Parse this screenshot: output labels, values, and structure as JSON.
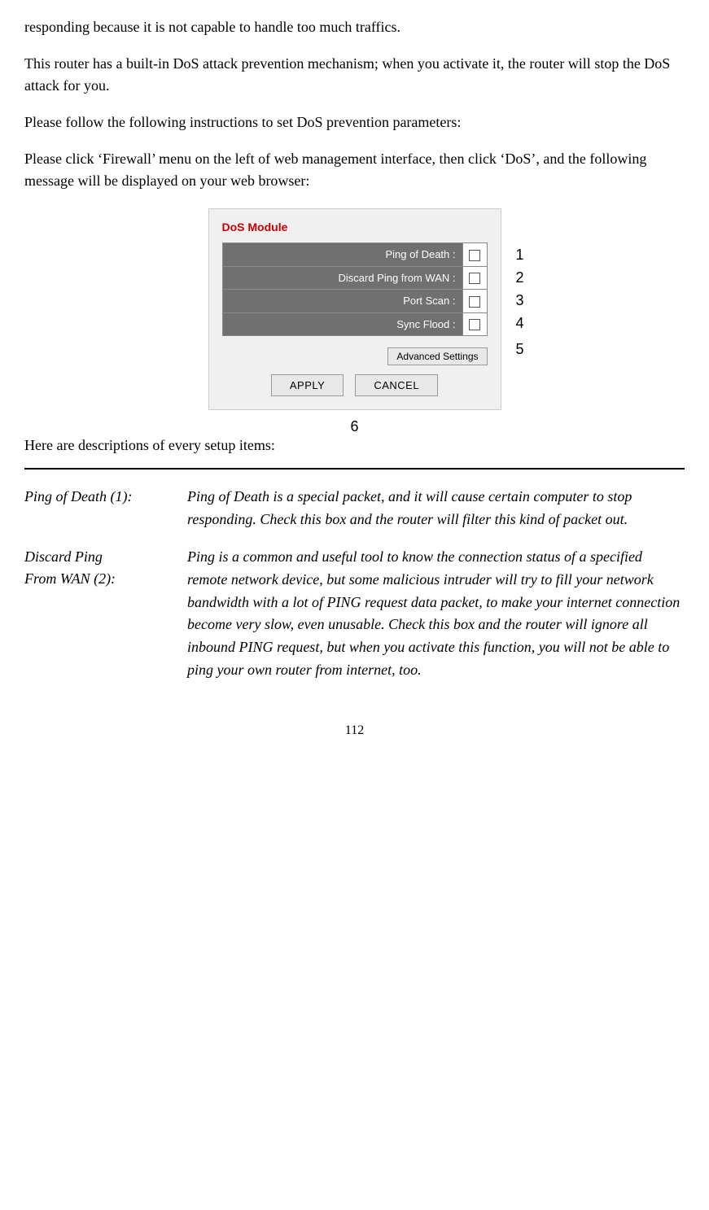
{
  "intro": {
    "para1": "responding because it is not capable to handle too much traffics.",
    "para2": "This router has a built-in DoS attack prevention mechanism; when you activate it, the router will stop the DoS attack for you.",
    "para3": "Please follow the following instructions to set DoS prevention parameters:",
    "para4": "Please click ‘Firewall’ menu on the left of web management interface, then click ‘DoS’, and the following message will be displayed on your web browser:"
  },
  "dos_module": {
    "title": "DoS Module",
    "rows": [
      {
        "label": "Ping of Death :"
      },
      {
        "label": "Discard Ping from WAN :"
      },
      {
        "label": "Port Scan :"
      },
      {
        "label": "Sync Flood :"
      }
    ],
    "advanced_settings_btn": "Advanced Settings",
    "apply_btn": "APPLY",
    "cancel_btn": "CANCEL",
    "number_labels": [
      "1",
      "2",
      "3",
      "4",
      "5",
      "6"
    ]
  },
  "descriptions": {
    "heading": "Here are descriptions of every setup items:",
    "items": [
      {
        "label": "Ping of Death (1):",
        "text": "Ping of Death is a special packet, and it will cause certain computer to stop responding. Check this box and the router will filter this kind of packet out."
      },
      {
        "label": "Discard Ping\nFrom WAN (2):",
        "text": "Ping is a common and useful tool to know the connection status of a specified remote network device, but some malicious intruder will try to fill your network bandwidth with a lot of PING request data packet, to make your internet connection become very slow, even unusable. Check this box and the router will ignore all inbound PING request, but when you activate this function, you will not be able to ping your own router from internet, too."
      }
    ]
  },
  "page_number": "112"
}
